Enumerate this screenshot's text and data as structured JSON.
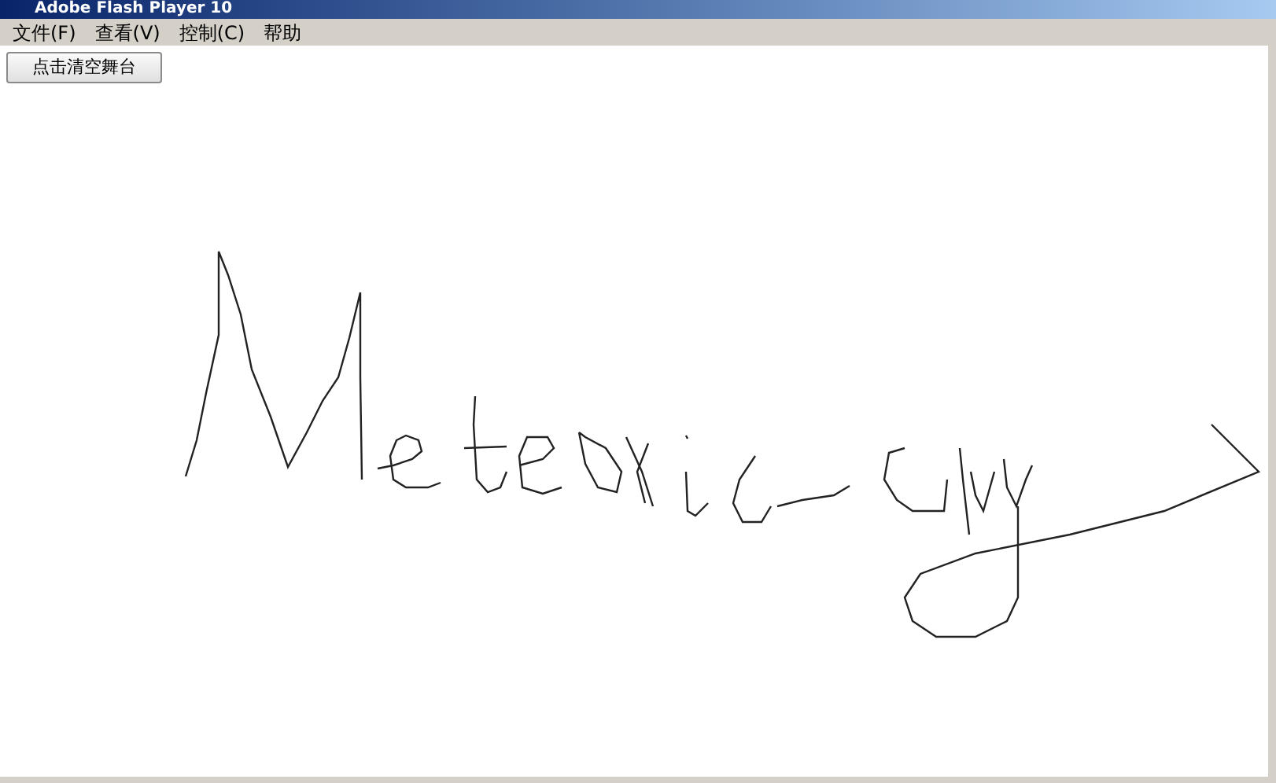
{
  "window": {
    "title": "Adobe Flash Player 10"
  },
  "menu": [
    {
      "label": "文件(F)"
    },
    {
      "label": "查看(V)"
    },
    {
      "label": "控制(C)"
    },
    {
      "label": "帮助"
    }
  ],
  "stage": {
    "button": "点击清空舞台"
  }
}
